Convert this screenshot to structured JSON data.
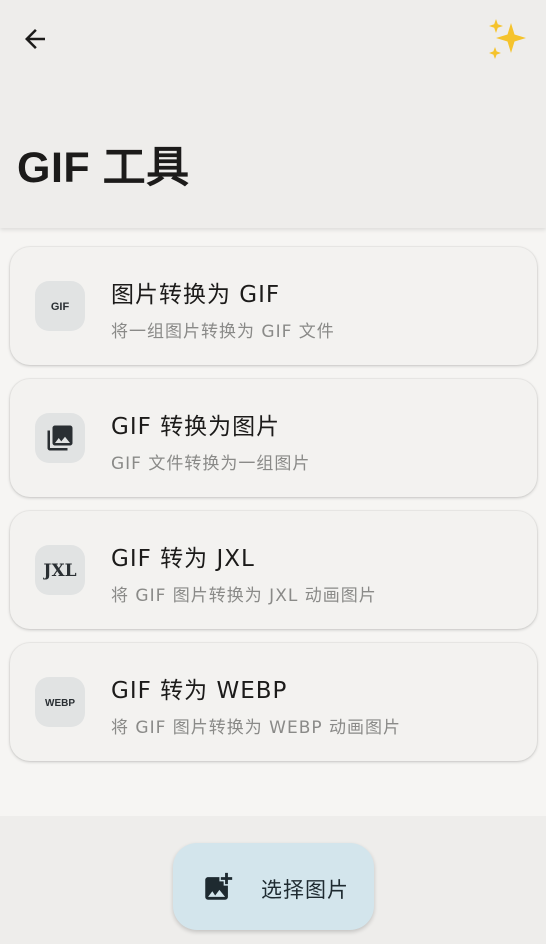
{
  "header": {
    "title": "GIF 工具",
    "back_icon": "arrow-left-icon",
    "action_icon": "sparkles-icon"
  },
  "tools": [
    {
      "title": "图片转换为 GIF",
      "subtitle": "将一组图片转换为 GIF 文件",
      "icon": "gif-badge-icon"
    },
    {
      "title": "GIF 转换为图片",
      "subtitle": "GIF 文件转换为一组图片",
      "icon": "image-collection-icon"
    },
    {
      "title": "GIF 转为 JXL",
      "subtitle": "将 GIF 图片转换为 JXL 动画图片",
      "icon": "jxl-logo-icon"
    },
    {
      "title": "GIF 转为 WEBP",
      "subtitle": "将 GIF 图片转换为 WEBP 动画图片",
      "icon": "webp-badge-icon"
    }
  ],
  "fab": {
    "label": "选择图片",
    "icon": "add-photo-icon"
  },
  "colors": {
    "background": "#f6f5f3",
    "bar": "#eeedeb",
    "card": "#f3f2f0",
    "icon_bg": "#e1e3e3",
    "fab_bg": "#d3e5ec",
    "subtitle_text": "#8a8a88"
  }
}
